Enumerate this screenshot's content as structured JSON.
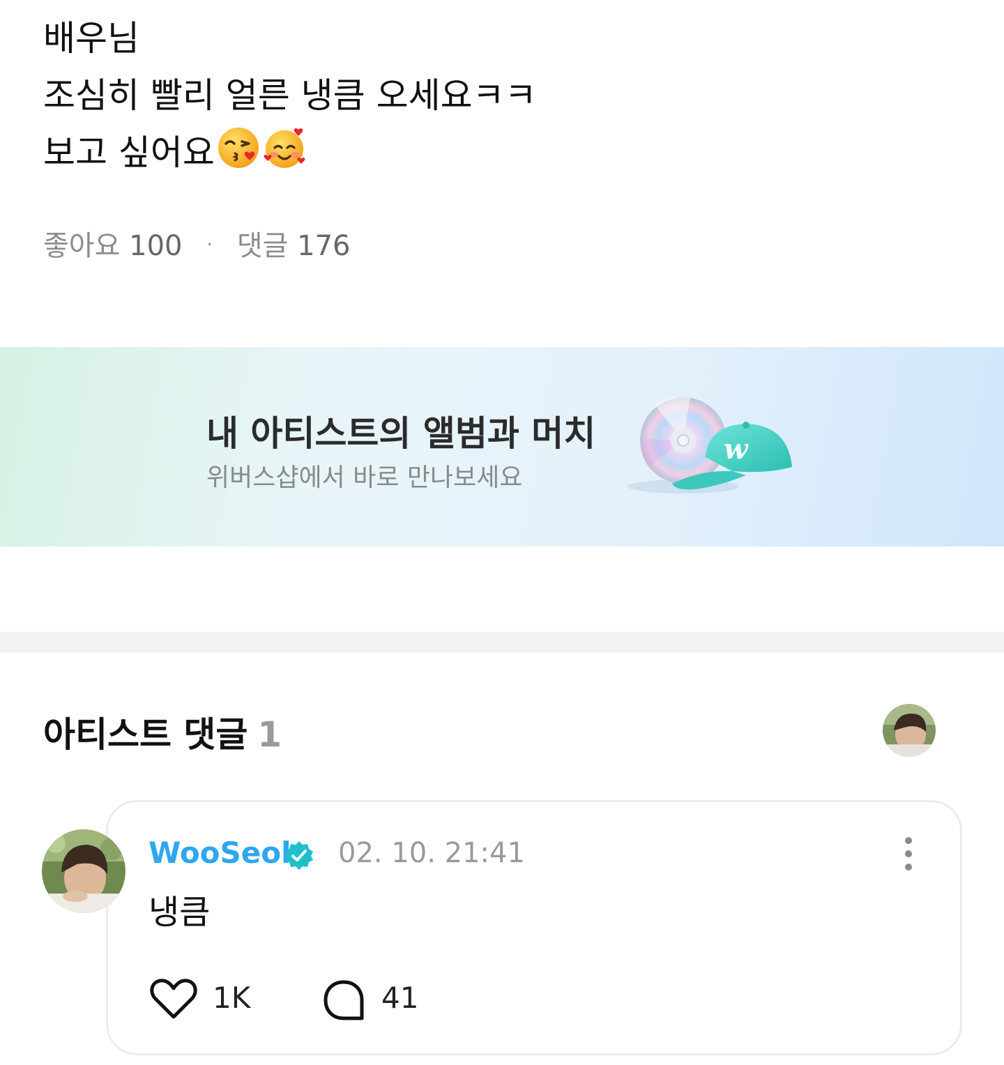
{
  "post": {
    "lines": [
      "배우님",
      "조심히 빨리 얼른 냉큼 오세요ㅋㅋ",
      "보고 싶어요"
    ],
    "emojis": [
      "kissing-face-heart-icon",
      "smiling-face-hearts-icon"
    ]
  },
  "stats": {
    "likes_label": "좋아요",
    "likes_count": "100",
    "separator": "·",
    "comments_label": "댓글",
    "comments_count": "176"
  },
  "banner": {
    "title": "내 아티스트의 앨범과 머치",
    "subtitle": "위버스샵에서 바로 만나보세요",
    "art": [
      "cd-icon",
      "cap-icon"
    ],
    "colors": {
      "gradient_start": "#d6f1e4",
      "gradient_end": "#d0e6fb"
    }
  },
  "artist_comments": {
    "title": "아티스트 댓글",
    "count": "1",
    "avatar": "artist-avatar"
  },
  "comment": {
    "author": "WooSeok",
    "verified_icon": "verified-badge-icon",
    "timestamp": "02. 10. 21:41",
    "text": "냉큼",
    "likes": "1K",
    "replies": "41",
    "colors": {
      "author": "#2fa6f0",
      "verified": "#1fc0c9"
    }
  }
}
